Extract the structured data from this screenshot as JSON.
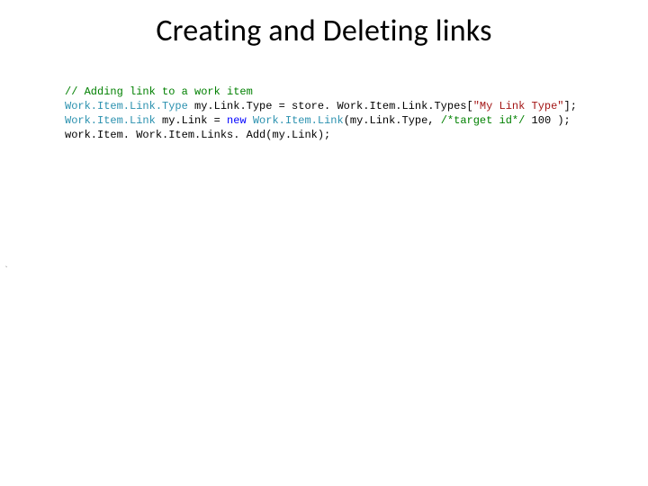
{
  "title": "Creating and Deleting links",
  "code": {
    "l1": {
      "comment": "// Adding link to a work item"
    },
    "l2": {
      "type1": "Work.Item.Link.Type",
      "var": " my.Link.Type = store. Work.Item.Link.Types[",
      "str": "\"My Link Type\"",
      "end": "];"
    },
    "l3": {
      "type1": "Work.Item.Link",
      "seg1": " my.Link = ",
      "kw": "new",
      "seg2": " ",
      "type2": "Work.Item.Link",
      "seg3": "(my.Link.Type, ",
      "comment": "/*target id*/",
      "seg4": " 100 );"
    },
    "l4": {
      "text": "work.Item. Work.Item.Links. Add(my.Link);"
    }
  },
  "stray": "`"
}
